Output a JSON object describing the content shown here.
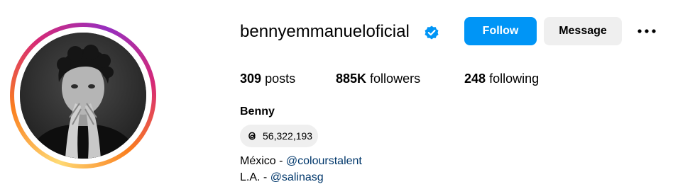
{
  "profile": {
    "username": "bennyemmanueloficial",
    "verified": true,
    "full_name": "Benny"
  },
  "actions": {
    "follow_label": "Follow",
    "message_label": "Message",
    "more_icon": "more-options-icon"
  },
  "stats": {
    "posts_count": "309",
    "posts_label": "posts",
    "followers_count": "885K",
    "followers_label": "followers",
    "following_count": "248",
    "following_label": "following"
  },
  "threads": {
    "icon": "threads-icon",
    "count": "56,322,193"
  },
  "bio": {
    "line1_prefix": "México - ",
    "line1_mention": "@colourstalent",
    "line2_prefix": "L.A. - ",
    "line2_mention": "@salinasg"
  },
  "colors": {
    "follow_button": "#0095f6",
    "secondary_button": "#efefef",
    "mention_link": "#00376b",
    "verified_badge": "#0095f6"
  }
}
